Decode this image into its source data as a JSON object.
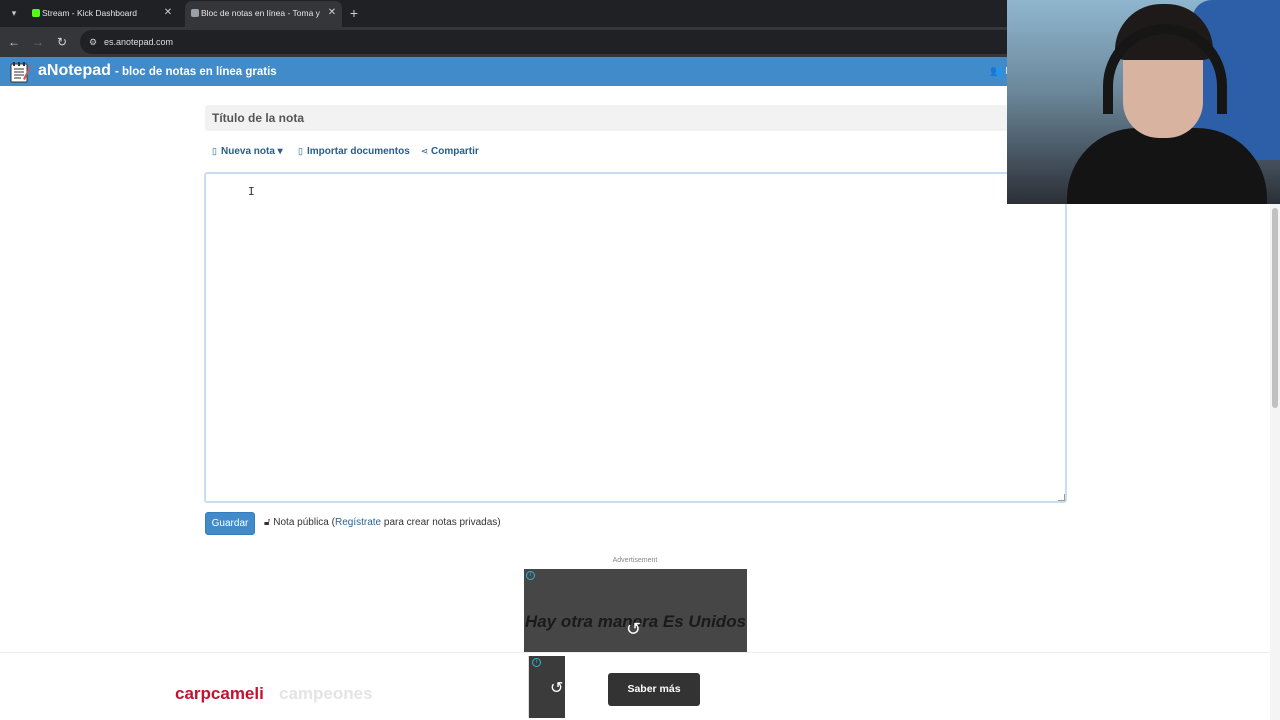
{
  "browser": {
    "tabs": [
      {
        "title": "Stream - Kick Dashboard",
        "favicon_color": "#53fc18",
        "active": false
      },
      {
        "title": "Bloc de notas en línea - Toma y",
        "favicon_color": "#9aa0a6",
        "active": true
      }
    ],
    "url": "es.anotepad.com"
  },
  "site": {
    "brand": "aNotepad",
    "tagline": "- bloc de notas en línea gratis",
    "header_user_glyph": "👥 I",
    "accent_color": "#428bca"
  },
  "note": {
    "title_placeholder": "Título de la nota",
    "title_value": "",
    "body_value": "",
    "toolbar": {
      "new_note": "Nueva nota",
      "import_docs": "Importar documentos",
      "share": "Compartir"
    },
    "save_label": "Guardar",
    "public_note_prefix": "Nota pública (",
    "register_link": "Regístrate",
    "public_note_suffix": " para crear notas privadas)"
  },
  "ad": {
    "label": "Advertisement",
    "headline": "Hay otra manera Es Unidos",
    "cta": "Saber más"
  },
  "footer_ad": {
    "brand_primary": "carpcameli",
    "brand_secondary": "campeones"
  }
}
